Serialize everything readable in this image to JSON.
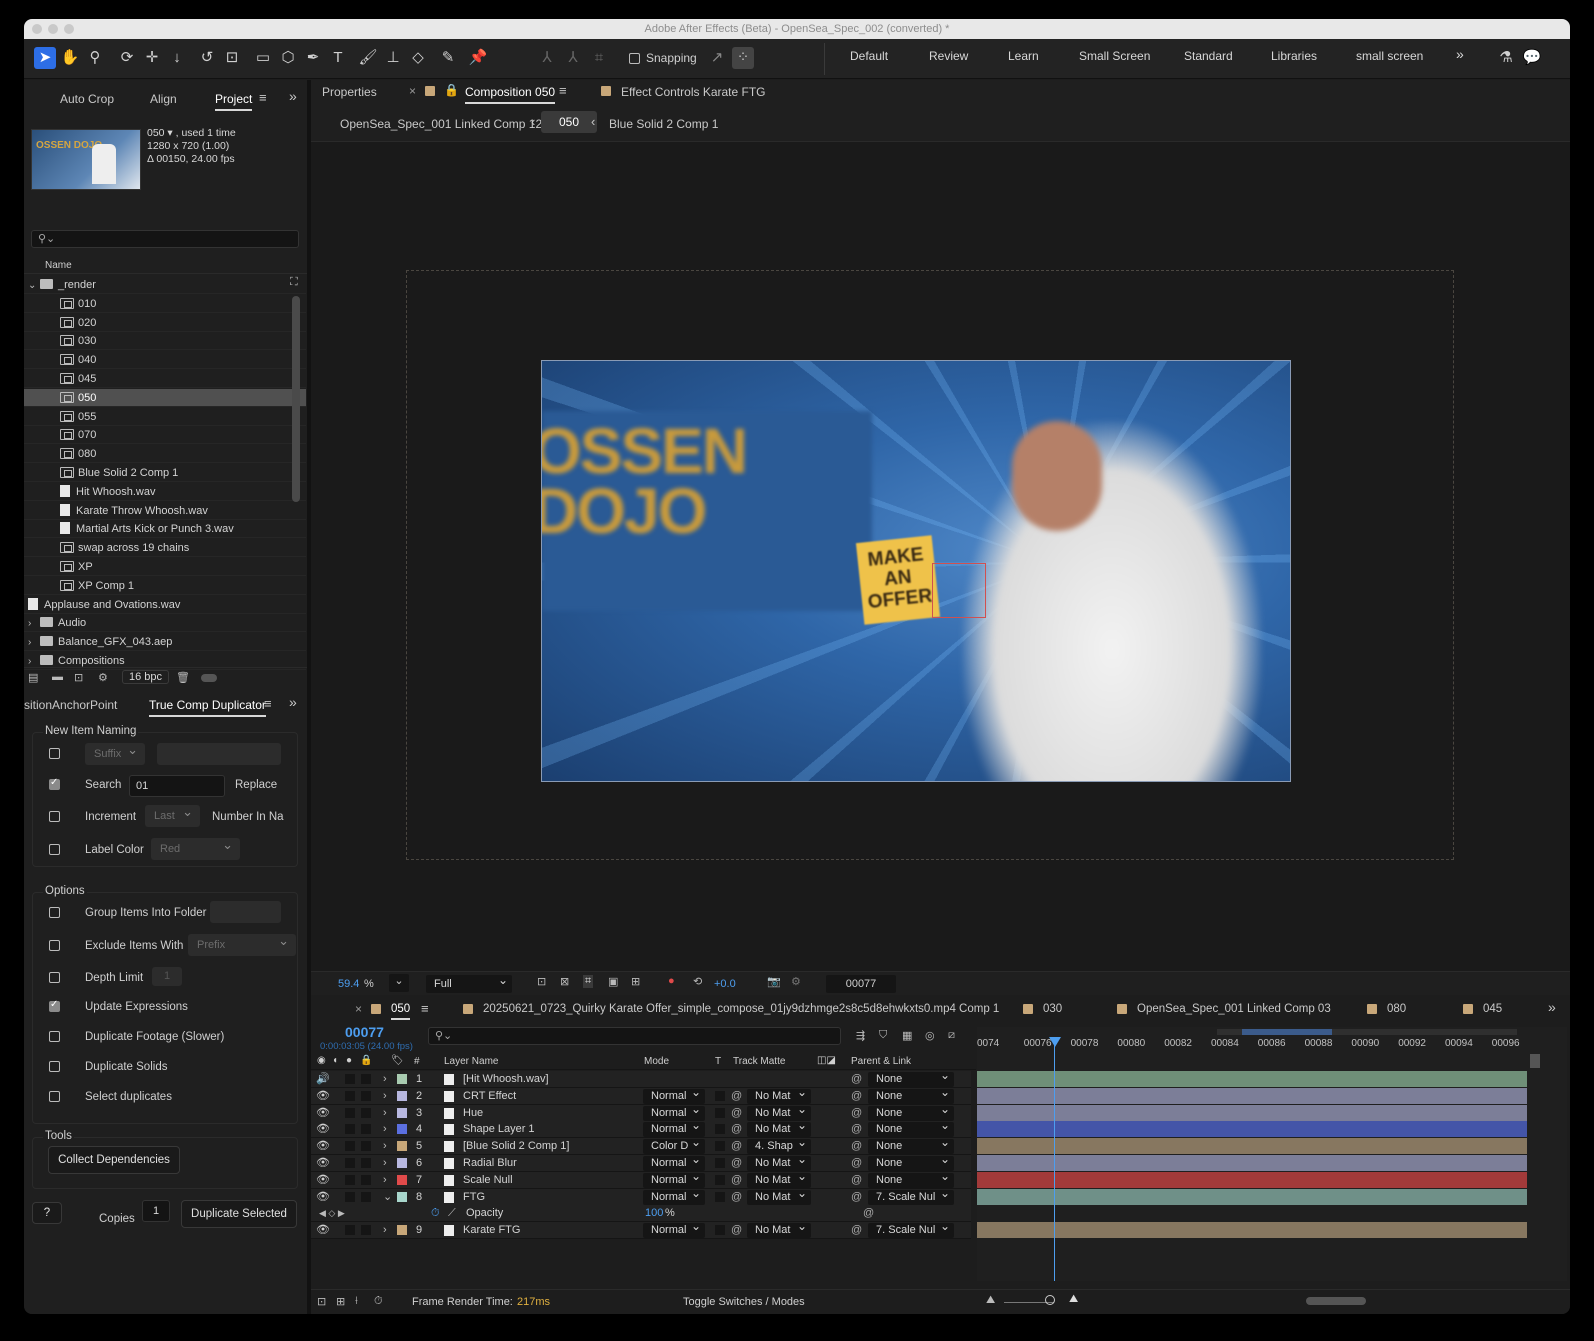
{
  "window": {
    "title": "Adobe After Effects (Beta) - OpenSea_Spec_002 (converted) *"
  },
  "toolbar": {
    "snapping_label": "Snapping",
    "workspaces": [
      "Default",
      "Review",
      "Learn",
      "Small Screen",
      "Standard",
      "Libraries",
      "small screen"
    ]
  },
  "left_tabs": {
    "auto_crop": "Auto Crop",
    "align": "Align",
    "project": "Project"
  },
  "project": {
    "thumb_text": "OSSEN DOJO",
    "info_line1": "050 ▾ , used 1 time",
    "info_line2": "1280 x 720 (1.00)",
    "info_line3": "Δ 00150, 24.00 fps",
    "search_placeholder": "",
    "column_name": "Name",
    "items": [
      {
        "label": "_render",
        "type": "folder",
        "indent": 0,
        "expanded": true
      },
      {
        "label": "010",
        "type": "comp",
        "indent": 1
      },
      {
        "label": "020",
        "type": "comp",
        "indent": 1
      },
      {
        "label": "030",
        "type": "comp",
        "indent": 1
      },
      {
        "label": "040",
        "type": "comp",
        "indent": 1
      },
      {
        "label": "045",
        "type": "comp",
        "indent": 1
      },
      {
        "label": "050",
        "type": "comp",
        "indent": 1,
        "selected": true
      },
      {
        "label": "055",
        "type": "comp",
        "indent": 1
      },
      {
        "label": "070",
        "type": "comp",
        "indent": 1
      },
      {
        "label": "080",
        "type": "comp",
        "indent": 1
      },
      {
        "label": "Blue Solid 2 Comp 1",
        "type": "comp",
        "indent": 1
      },
      {
        "label": "Hit Whoosh.wav",
        "type": "file",
        "indent": 1
      },
      {
        "label": "Karate Throw Whoosh.wav",
        "type": "file",
        "indent": 1
      },
      {
        "label": "Martial Arts Kick or Punch 3.wav",
        "type": "file",
        "indent": 1
      },
      {
        "label": "swap across 19 chains",
        "type": "comp",
        "indent": 1
      },
      {
        "label": "XP",
        "type": "comp",
        "indent": 1
      },
      {
        "label": "XP Comp 1",
        "type": "comp",
        "indent": 1
      },
      {
        "label": "Applause and Ovations.wav",
        "type": "file",
        "indent": 0
      },
      {
        "label": "Audio",
        "type": "folder",
        "indent": 0,
        "expanded": false
      },
      {
        "label": "Balance_GFX_043.aep",
        "type": "folder",
        "indent": 0,
        "expanded": false
      },
      {
        "label": "Compositions",
        "type": "folder",
        "indent": 0,
        "expanded": false
      }
    ],
    "bpc": "16 bpc"
  },
  "tcd": {
    "tab_left": "sitionAnchorPoint",
    "tab_active": "True Comp Duplicator",
    "new_item_naming": "New Item Naming",
    "suffix": "Suffix",
    "search_label": "Search",
    "search_value": "01",
    "replace_label": "Replace",
    "increment_label": "Increment",
    "last": "Last",
    "number_in_name": "Number In Na",
    "label_color_label": "Label Color",
    "label_color_value": "Red",
    "options": "Options",
    "group_items": "Group Items Into Folder",
    "exclude_items": "Exclude Items With",
    "prefix": "Prefix",
    "depth_limit": "Depth Limit",
    "depth_value": "1",
    "update_expressions": "Update Expressions",
    "duplicate_footage": "Duplicate Footage (Slower)",
    "duplicate_solids": "Duplicate Solids",
    "select_duplicates": "Select duplicates",
    "tools": "Tools",
    "collect_dependencies": "Collect Dependencies",
    "help": "?",
    "copies_label": "Copies",
    "copies_value": "1",
    "duplicate_selected": "Duplicate Selected"
  },
  "viewer": {
    "tab_properties": "Properties",
    "tab_comp": "Composition 050",
    "tab_effect": "Effect Controls Karate FTG",
    "crumb_left": "OpenSea_Spec_001 Linked Comp 12",
    "crumb_mid": "050",
    "crumb_right": "Blue Solid 2 Comp 1",
    "frame_sign_text": "MAKE AN OFFER",
    "frame_bg_text": "OSSEN DOJO",
    "zoom": "59.4",
    "zoom_unit": "%",
    "resolution": "Full",
    "exposure": "+0.0",
    "frame": "00077"
  },
  "timeline": {
    "tabs": [
      {
        "label": "050",
        "color": "#c8a779",
        "active": true
      },
      {
        "label": "20250621_0723_Quirky Karate Offer_simple_compose_01jy9dzhmge2s8c5d8ehwkxts0.mp4 Comp 1",
        "color": "#c8a779"
      },
      {
        "label": "030",
        "color": "#c8a779"
      },
      {
        "label": "OpenSea_Spec_001 Linked Comp 03",
        "color": "#c8a779"
      },
      {
        "label": "080",
        "color": "#c8a779"
      },
      {
        "label": "045",
        "color": "#c8a779"
      }
    ],
    "timecode": "00077",
    "timecode_sub": "0:00:03:05 (24.00 fps)",
    "col_hash": "#",
    "col_layer_name": "Layer Name",
    "col_mode": "Mode",
    "col_t": "T",
    "col_track_matte": "Track Matte",
    "col_parent": "Parent & Link",
    "ruler": [
      "0074",
      "00076",
      "00078",
      "00080",
      "00082",
      "00084",
      "00086",
      "00088",
      "00090",
      "00092",
      "00094",
      "00096"
    ],
    "layers": [
      {
        "num": "1",
        "name": "[Hit Whoosh.wav]",
        "color": "#a8cbb0",
        "mode": "",
        "matte": "",
        "parent": "None",
        "track_color": "#6f8f78",
        "audio": true
      },
      {
        "num": "2",
        "name": "CRT Effect",
        "color": "#b8b8e0",
        "mode": "Normal",
        "matte": "No Mat",
        "parent": "None",
        "track_color": "#7c7e98"
      },
      {
        "num": "3",
        "name": "Hue",
        "color": "#b8b8e0",
        "mode": "Normal",
        "matte": "No Mat",
        "parent": "None",
        "track_color": "#7c7e98"
      },
      {
        "num": "4",
        "name": "Shape Layer 1",
        "color": "#5b6fe0",
        "mode": "Normal",
        "matte": "No Mat",
        "parent": "None",
        "track_color": "#4455a8"
      },
      {
        "num": "5",
        "name": "[Blue Solid 2 Comp 1]",
        "color": "#c8a779",
        "mode": "Color D",
        "matte": "4. Shap",
        "parent": "None",
        "track_color": "#877760"
      },
      {
        "num": "6",
        "name": "Radial Blur",
        "color": "#b8b8e0",
        "mode": "Normal",
        "matte": "No Mat",
        "parent": "None",
        "track_color": "#7c7e98"
      },
      {
        "num": "7",
        "name": "Scale Null",
        "color": "#e04a4a",
        "mode": "Normal",
        "matte": "No Mat",
        "parent": "None",
        "track_color": "#a23a3a"
      },
      {
        "num": "8",
        "name": "FTG",
        "color": "#a8d6cc",
        "mode": "Normal",
        "matte": "No Mat",
        "parent": "7. Scale Nul",
        "track_color": "#6f9088",
        "expanded": true
      },
      {
        "num": "",
        "name": "Opacity",
        "property": true,
        "value": "100",
        "value_unit": "%"
      },
      {
        "num": "9",
        "name": "Karate FTG",
        "color": "#c8a779",
        "mode": "Normal",
        "matte": "No Mat",
        "parent": "7. Scale Nul",
        "track_color": "#877760"
      }
    ],
    "frame_render_label": "Frame Render Time:",
    "frame_render_value": "217ms",
    "toggle_label": "Toggle Switches / Modes"
  }
}
